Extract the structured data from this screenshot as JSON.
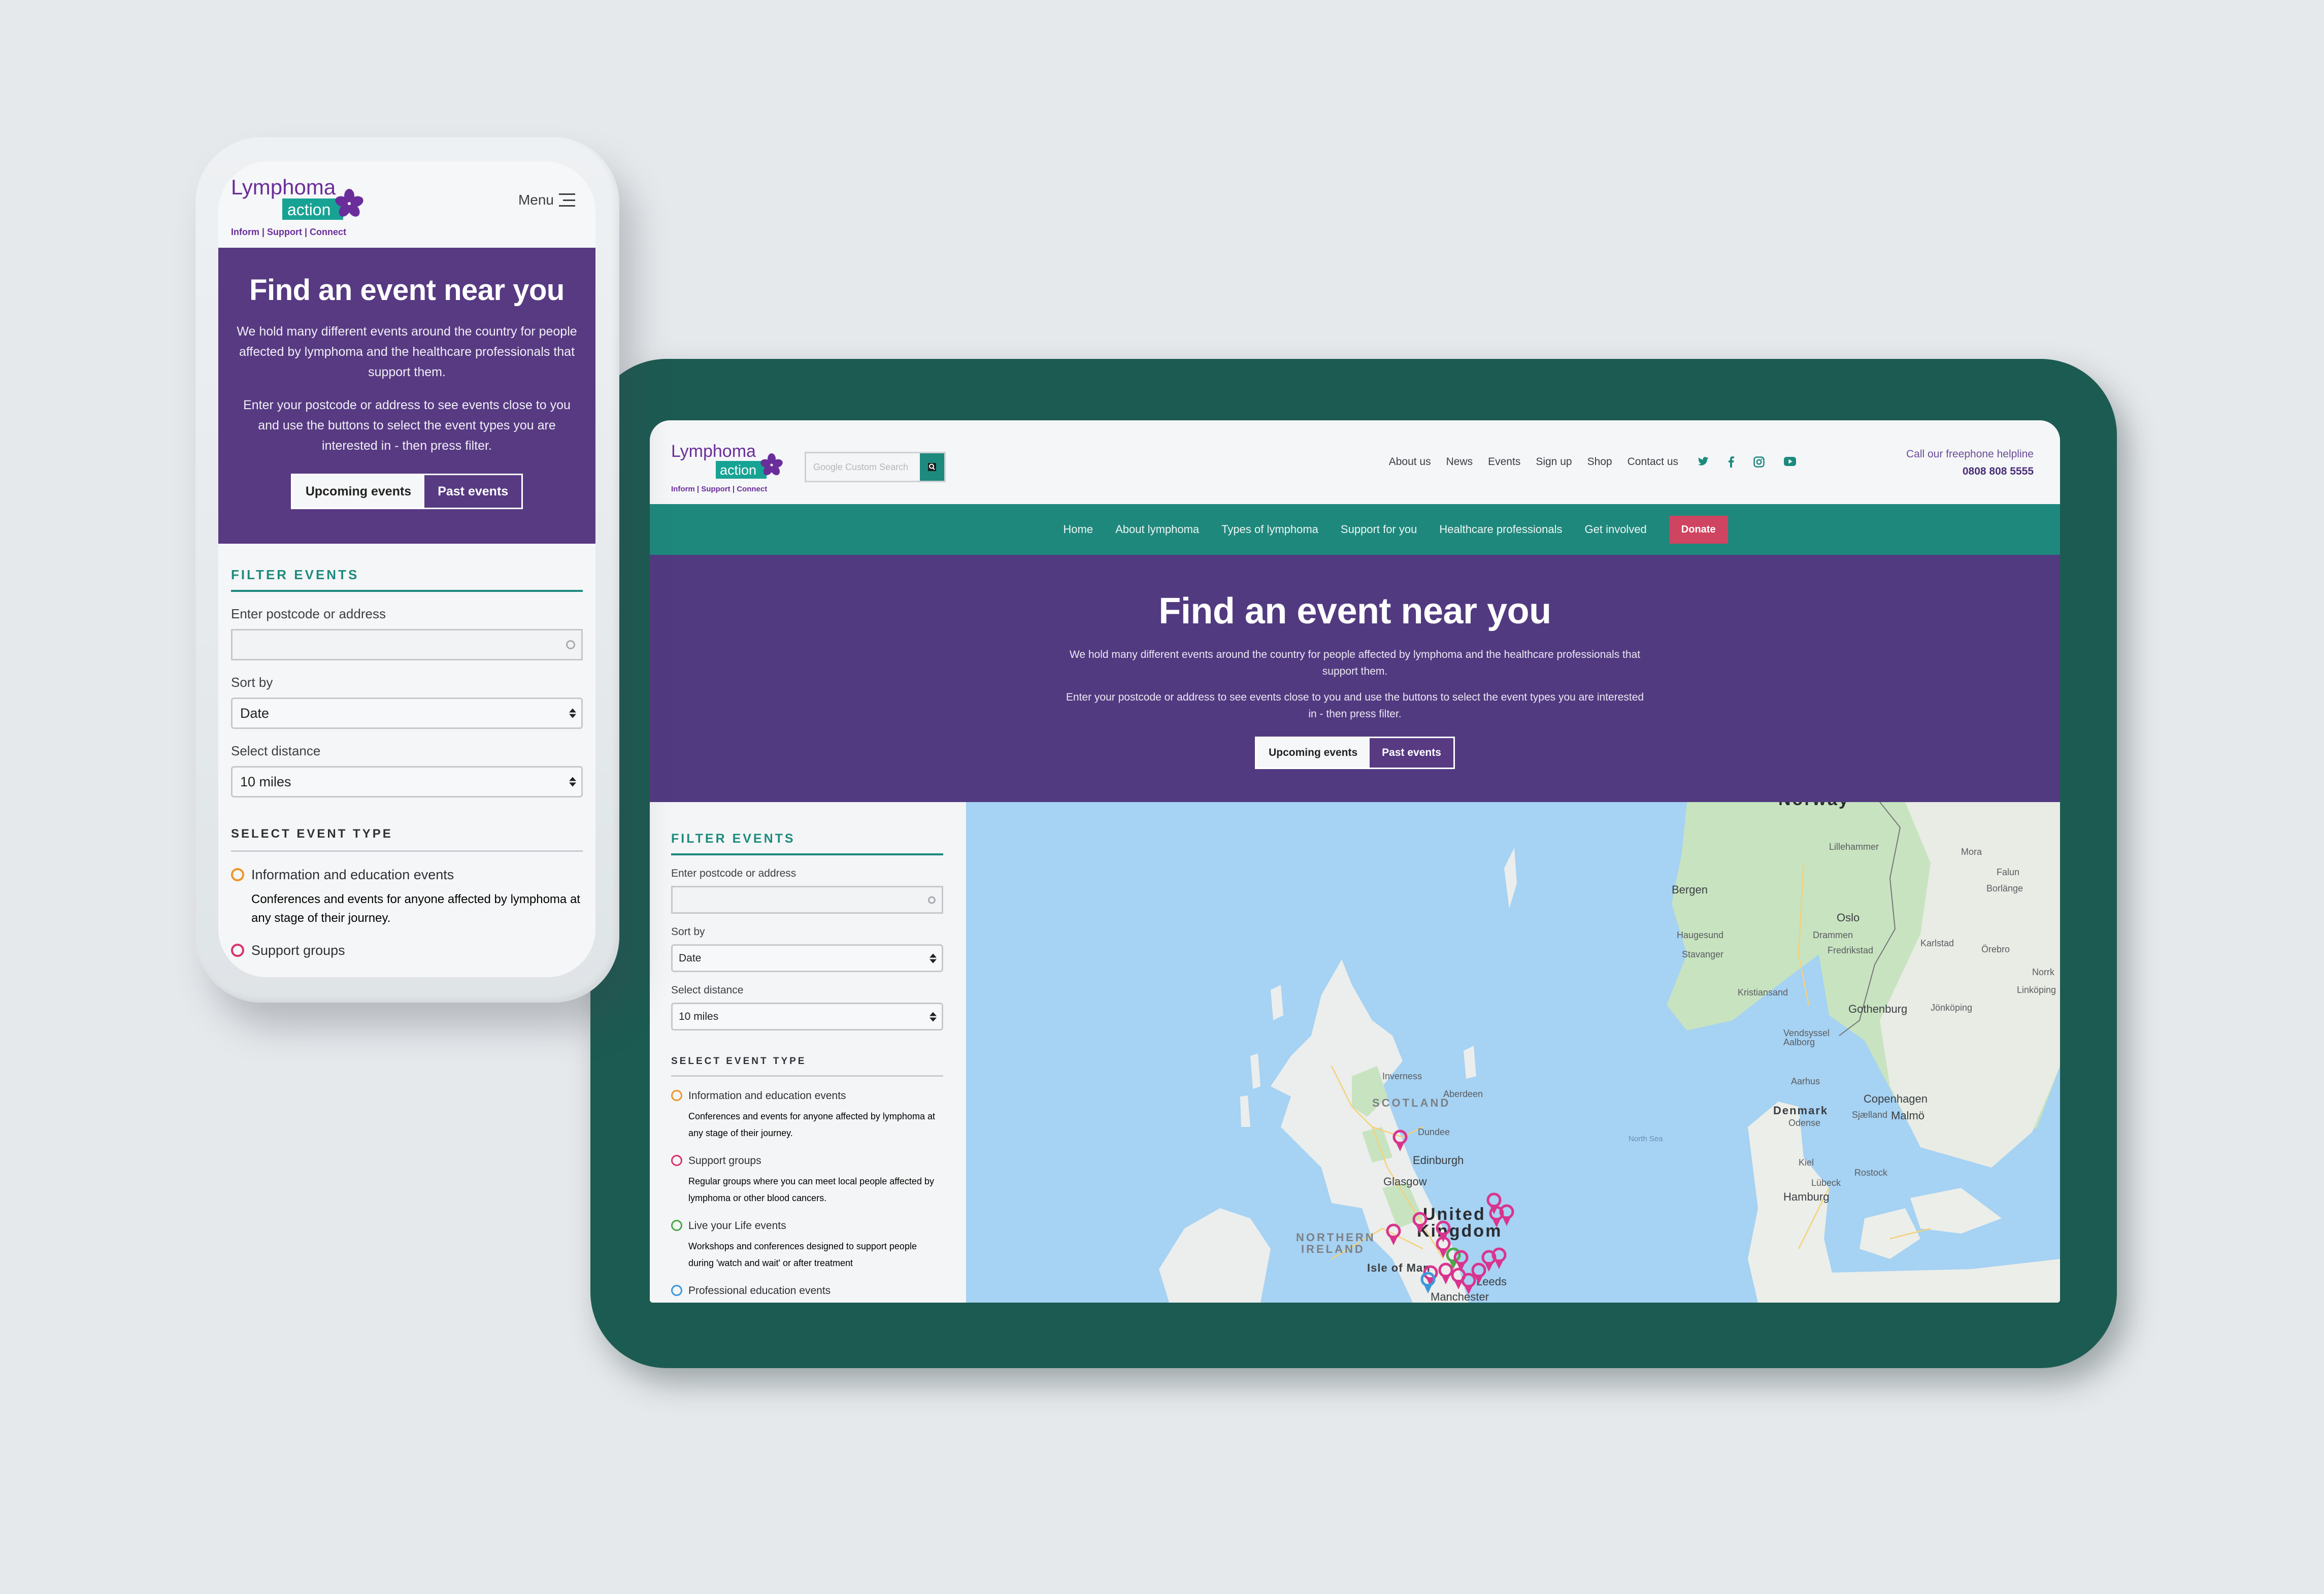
{
  "brand": {
    "name_line1": "Lymphoma",
    "name_line2": "action",
    "tagline": "Inform | Support | Connect",
    "purple": "#6a2e9a",
    "teal": "#1d8a7e"
  },
  "mobile": {
    "menu_label": "Menu",
    "hero": {
      "title": "Find an event near you",
      "intro": "We hold many different events around the country for people affected by lymphoma and the healthcare professionals that support them.",
      "instructions": "Enter your postcode or address to see events close to you and use the buttons to select the event types you are interested in - then press filter.",
      "upcoming_label": "Upcoming events",
      "past_label": "Past events"
    }
  },
  "desktop": {
    "search_placeholder": "Google Custom Search",
    "utility_nav": [
      "About us",
      "News",
      "Events",
      "Sign up",
      "Shop",
      "Contact us"
    ],
    "social_icons": [
      "twitter-icon",
      "facebook-icon",
      "instagram-icon",
      "youtube-icon"
    ],
    "helpline_label": "Call our freephone helpline",
    "helpline_number": "0808 808 5555",
    "main_nav": [
      "Home",
      "About lymphoma",
      "Types of lymphoma",
      "Support for you",
      "Healthcare professionals",
      "Get involved"
    ],
    "donate_label": "Donate",
    "hero": {
      "title": "Find an event near you",
      "intro": "We hold many different events around the country for people affected by lymphoma and the healthcare professionals that support them.",
      "instructions": "Enter your postcode or address to see events close to you and use the buttons to select the event types you are interested in - then press filter.",
      "upcoming_label": "Upcoming events",
      "past_label": "Past events"
    }
  },
  "filter": {
    "title": "FILTER EVENTS",
    "postcode_label": "Enter postcode or address",
    "postcode_value": "",
    "sort_label": "Sort by",
    "sort_value": "Date",
    "distance_label": "Select distance",
    "distance_value": "10 miles",
    "event_type_title": "SELECT EVENT TYPE",
    "event_types": [
      {
        "name": "Information and education events",
        "desc": "Conferences and events for anyone affected by lymphoma at any stage of their journey.",
        "color": "#f0962a"
      },
      {
        "name": "Support groups",
        "desc": "Regular groups where you can meet local people affected by lymphoma or other blood cancers.",
        "color": "#d9346a"
      },
      {
        "name": "Live your Life events",
        "desc": "Workshops and conferences designed to support people during 'watch and wait' or after treatment",
        "color": "#4aa84a"
      },
      {
        "name": "Professional education events",
        "desc": "",
        "color": "#3a98dc"
      }
    ]
  },
  "map": {
    "labels": {
      "norway": "Norway",
      "bergen": "Bergen",
      "haugesund": "Haugesund",
      "stavanger": "Stavanger",
      "kristiansand": "Kristiansand",
      "lillehammer": "Lillehammer",
      "oslo": "Oslo",
      "drammen": "Drammen",
      "fredrikstad": "Fredrikstad",
      "mora": "Mora",
      "falun": "Falun",
      "borlange": "Borlänge",
      "karlstad": "Karlstad",
      "orebro": "Örebro",
      "norrkoping": "Norrk",
      "linkoping": "Linköping",
      "gothenburg": "Gothenburg",
      "jonkoping": "Jönköping",
      "vendsyssel": "Vendsyssel",
      "aalborg": "Aalborg",
      "aarhus": "Aarhus",
      "denmark": "Denmark",
      "odense": "Odense",
      "sjaelland": "Sjælland",
      "copenhagen": "Copenhagen",
      "malmo": "Malmö",
      "kiel": "Kiel",
      "rostock": "Rostock",
      "lubeck": "Lübeck",
      "hamburg": "Hamburg",
      "north_sea": "North Sea",
      "inverness": "Inverness",
      "aberdeen": "Aberdeen",
      "scotland": "SCOTLAND",
      "dundee": "Dundee",
      "edinburgh": "Edinburgh",
      "glasgow": "Glasgow",
      "united": "United",
      "kingdom": "Kingdom",
      "northern": "NORTHERN",
      "ireland": "IRELAND",
      "isle_of_man": "Isle of Man",
      "leeds": "Leeds",
      "manchester": "Manchester"
    },
    "pin_colors": {
      "support": "#d9348e",
      "live": "#4aa84a",
      "professional": "#3a98dc"
    }
  }
}
